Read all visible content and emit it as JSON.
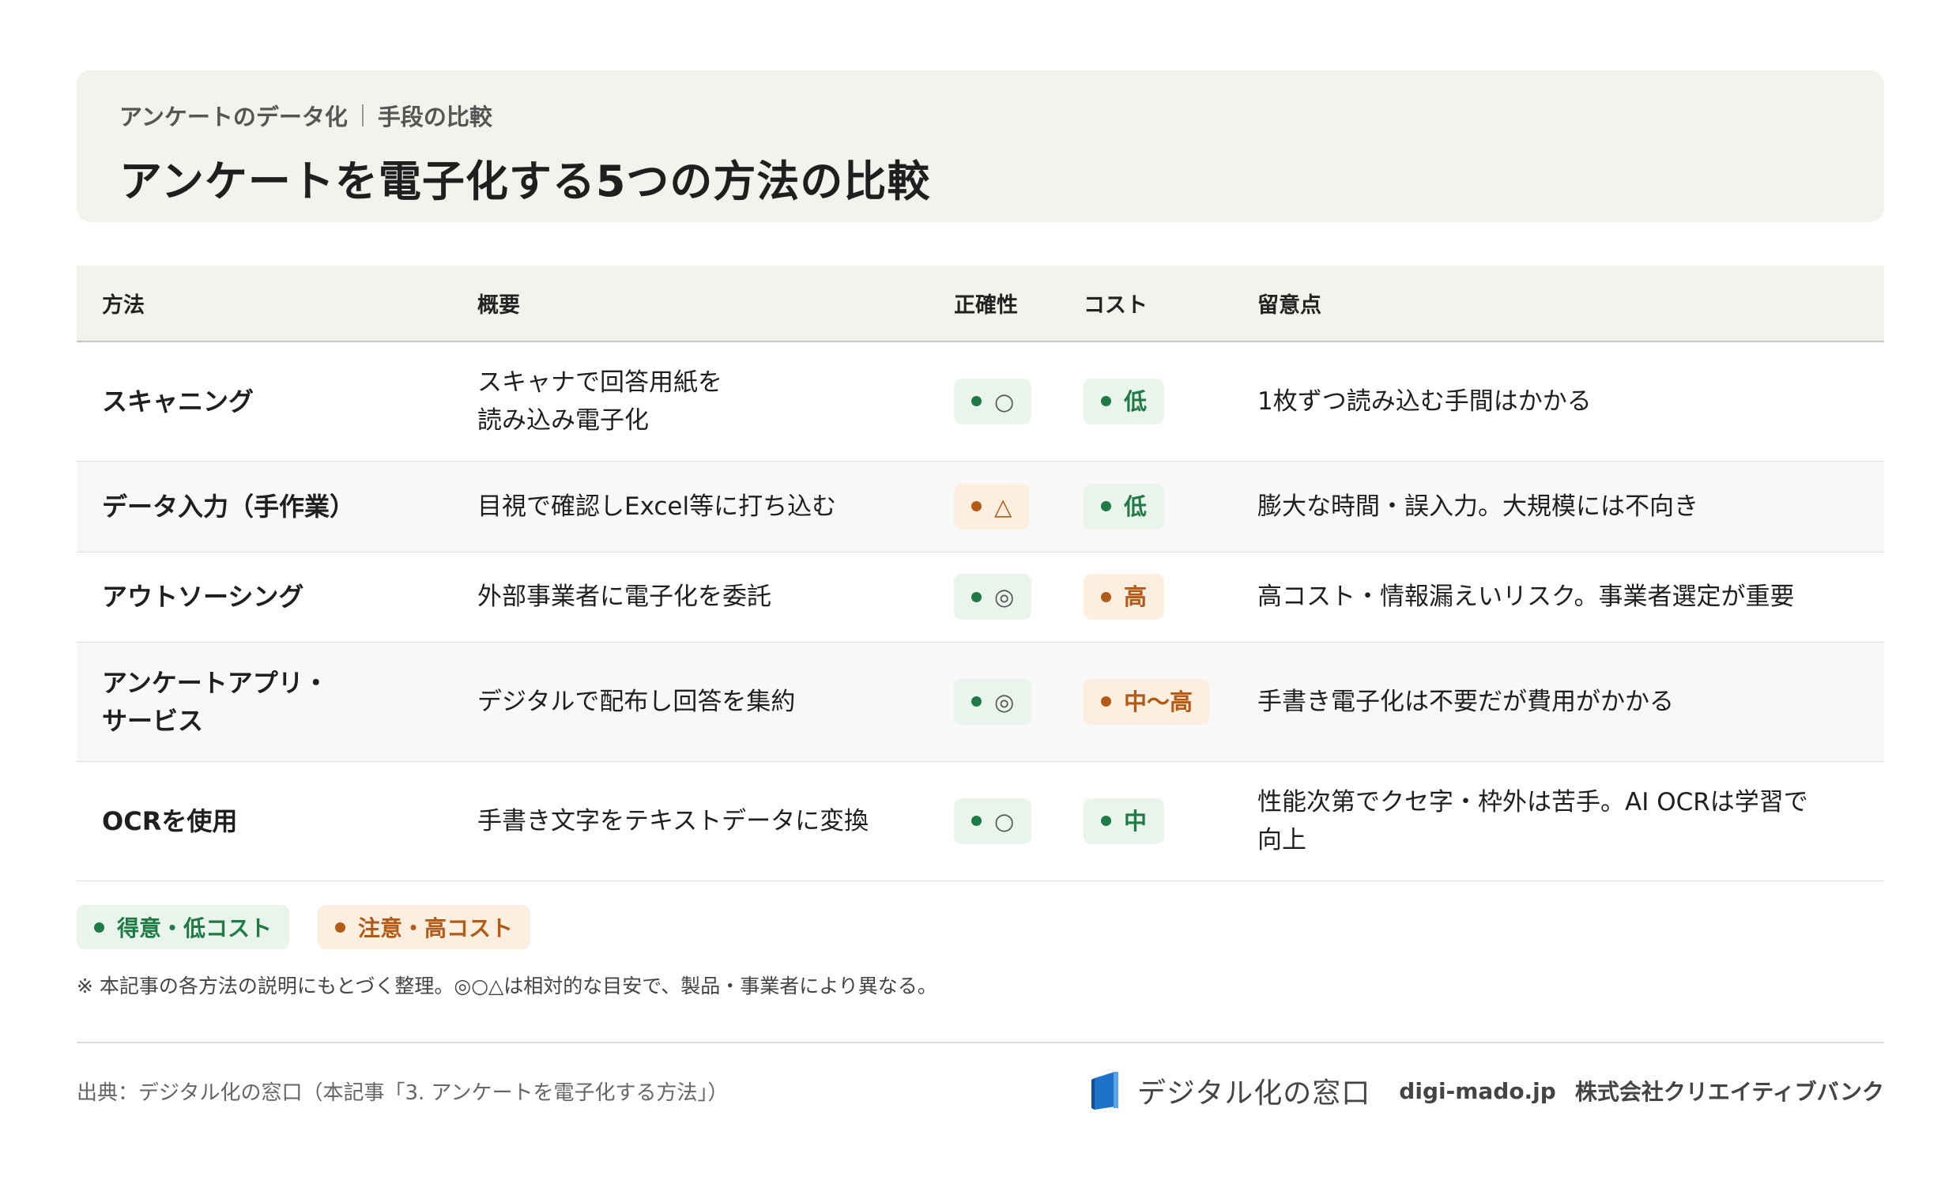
{
  "header": {
    "breadcrumb_1": "アンケートのデータ化",
    "breadcrumb_2": "手段の比較",
    "title": "アンケートを電子化する5つの方法の比較"
  },
  "table": {
    "columns": [
      "方法",
      "概要",
      "正確性",
      "コスト",
      "留意点"
    ],
    "rows": [
      {
        "method": "スキャニング",
        "summary": "スキャナで回答用紙を\n読み込み電子化",
        "accuracy": "○",
        "accuracy_status": "good",
        "cost": "低",
        "cost_status": "good",
        "note": "1枚ずつ読み込む手間はかかる"
      },
      {
        "method": "データ入力（手作業）",
        "summary": "目視で確認しExcel等に打ち込む",
        "accuracy": "△",
        "accuracy_status": "warn",
        "cost": "低",
        "cost_status": "good",
        "note": "膨大な時間・誤入力。大規模には不向き"
      },
      {
        "method": "アウトソーシング",
        "summary": "外部事業者に電子化を委託",
        "accuracy": "◎",
        "accuracy_status": "good",
        "cost": "高",
        "cost_status": "warn",
        "note": "高コスト・情報漏えいリスク。事業者選定が重要"
      },
      {
        "method": "アンケートアプリ・\nサービス",
        "summary": "デジタルで配布し回答を集約",
        "accuracy": "◎",
        "accuracy_status": "good",
        "cost": "中〜高",
        "cost_status": "warn",
        "note": "手書き電子化は不要だが費用がかかる"
      },
      {
        "method": "OCRを使用",
        "summary": "手書き文字をテキストデータに変換",
        "accuracy": "○",
        "accuracy_status": "good",
        "cost": "中",
        "cost_status": "good",
        "note": "性能次第でクセ字・枠外は苦手。AI OCRは学習で\n向上"
      }
    ]
  },
  "legend": {
    "good": "得意・低コスト",
    "warn": "注意・高コスト"
  },
  "colors": {
    "good": "#1f7a45",
    "warn": "#b35a16",
    "header_bg": "#f4f2ec",
    "logo_blue": "#1e73c8"
  },
  "note": "※ 本記事の各方法の説明にもとづく整理。◎○△は相対的な目安で、製品・事業者により異なる。",
  "footer": {
    "source": "出典：デジタル化の窓口（本記事「3. アンケートを電子化する方法」）",
    "logo_text": "デジタル化の窓口",
    "domain": "digi-mado.jp",
    "company": "株式会社クリエイティブバンク"
  }
}
